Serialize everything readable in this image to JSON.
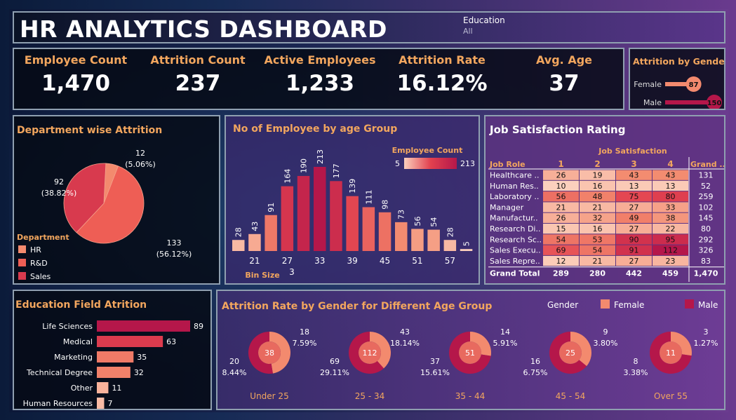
{
  "header": {
    "title": "HR ANALYTICS DASHBOARD",
    "filter_label": "Education",
    "filter_value": "All"
  },
  "kpis": [
    {
      "label": "Employee Count",
      "value": "1,470"
    },
    {
      "label": "Attrition Count",
      "value": "237"
    },
    {
      "label": "Active Employees",
      "value": "1,233"
    },
    {
      "label": "Attrition Rate",
      "value": "16.12%"
    },
    {
      "label": "Avg. Age",
      "value": "37"
    }
  ],
  "colors": {
    "accent_orange": "#f2a65e",
    "salmon": "#f38a6e",
    "red": "#e2414f",
    "crimson": "#b5174a",
    "light": "#fbc6b0"
  },
  "chart_data": [
    {
      "id": "gender",
      "type": "bar",
      "title": "Attrition by Gender",
      "categories": [
        "Female",
        "Male"
      ],
      "values": [
        87,
        150
      ]
    },
    {
      "id": "department",
      "type": "pie",
      "title": "Department wise Attrition",
      "legend_title": "Department",
      "slices": [
        {
          "name": "HR",
          "value": 12,
          "label": "12",
          "pct": "(5.06%)",
          "color": "#f38a6e"
        },
        {
          "name": "R&D",
          "value": 133,
          "label": "133",
          "pct": "(56.12%)",
          "color": "#ee5e55"
        },
        {
          "name": "Sales",
          "value": 92,
          "label": "92",
          "pct": "(38.82%)",
          "color": "#d83a4e"
        }
      ]
    },
    {
      "id": "age",
      "type": "bar",
      "title": "No of Employee by age Group",
      "legend_title": "Employee Count",
      "legend_min": "5",
      "legend_max": "213",
      "values": [
        28,
        43,
        91,
        164,
        190,
        213,
        177,
        139,
        111,
        98,
        73,
        56,
        54,
        28,
        5
      ],
      "x_ticks": [
        "21",
        "27",
        "33",
        "39",
        "45",
        "51",
        "57"
      ],
      "xlabel": "Bin Size",
      "bin_size": "3"
    },
    {
      "id": "jobsat",
      "type": "heatmap",
      "title": "Job Satisfaction Rating",
      "column_title": "Job Satisfaction",
      "row_header": "Job Role",
      "columns": [
        "1",
        "2",
        "3",
        "4"
      ],
      "total_header": "Grand ..",
      "rows": [
        {
          "role": "Healthcare ..",
          "values": [
            26,
            19,
            43,
            43
          ],
          "total": "131"
        },
        {
          "role": "Human Res..",
          "values": [
            10,
            16,
            13,
            13
          ],
          "total": "52"
        },
        {
          "role": "Laboratory ..",
          "values": [
            56,
            48,
            75,
            80
          ],
          "total": "259"
        },
        {
          "role": "Manager",
          "values": [
            21,
            21,
            27,
            33
          ],
          "total": "102"
        },
        {
          "role": "Manufactur..",
          "values": [
            26,
            32,
            49,
            38
          ],
          "total": "145"
        },
        {
          "role": "Research Di..",
          "values": [
            15,
            16,
            27,
            22
          ],
          "total": "80"
        },
        {
          "role": "Research Sc..",
          "values": [
            54,
            53,
            90,
            95
          ],
          "total": "292"
        },
        {
          "role": "Sales Execu..",
          "values": [
            69,
            54,
            91,
            112
          ],
          "total": "326"
        },
        {
          "role": "Sales Repre..",
          "values": [
            12,
            21,
            27,
            23
          ],
          "total": "83"
        }
      ],
      "grand_total": {
        "label": "Grand Total",
        "values": [
          "289",
          "280",
          "442",
          "459"
        ],
        "total": "1,470"
      }
    },
    {
      "id": "education",
      "type": "bar",
      "title": "Education Field Atrition",
      "categories": [
        "Life Sciences",
        "Medical",
        "Marketing",
        "Technical Degree",
        "Other",
        "Human Resources"
      ],
      "values": [
        89,
        63,
        35,
        32,
        11,
        7
      ]
    },
    {
      "id": "agegender",
      "type": "pie",
      "title": "Attrition Rate by Gender for Different Age Group",
      "legend_title": "Gender",
      "legend": [
        "Female",
        "Male"
      ],
      "groups": [
        {
          "label": "Under 25",
          "total": "38",
          "female": 18,
          "female_pct": "7.59%",
          "male": 20,
          "male_pct": "8.44%"
        },
        {
          "label": "25 - 34",
          "total": "112",
          "female": 43,
          "female_pct": "18.14%",
          "male": 69,
          "male_pct": "29.11%"
        },
        {
          "label": "35 - 44",
          "total": "51",
          "female": 14,
          "female_pct": "5.91%",
          "male": 37,
          "male_pct": "15.61%"
        },
        {
          "label": "45 - 54",
          "total": "25",
          "female": 9,
          "female_pct": "3.80%",
          "male": 16,
          "male_pct": "6.75%"
        },
        {
          "label": "Over 55",
          "total": "11",
          "female": 3,
          "female_pct": "1.27%",
          "male": 8,
          "male_pct": "3.38%"
        }
      ]
    }
  ]
}
